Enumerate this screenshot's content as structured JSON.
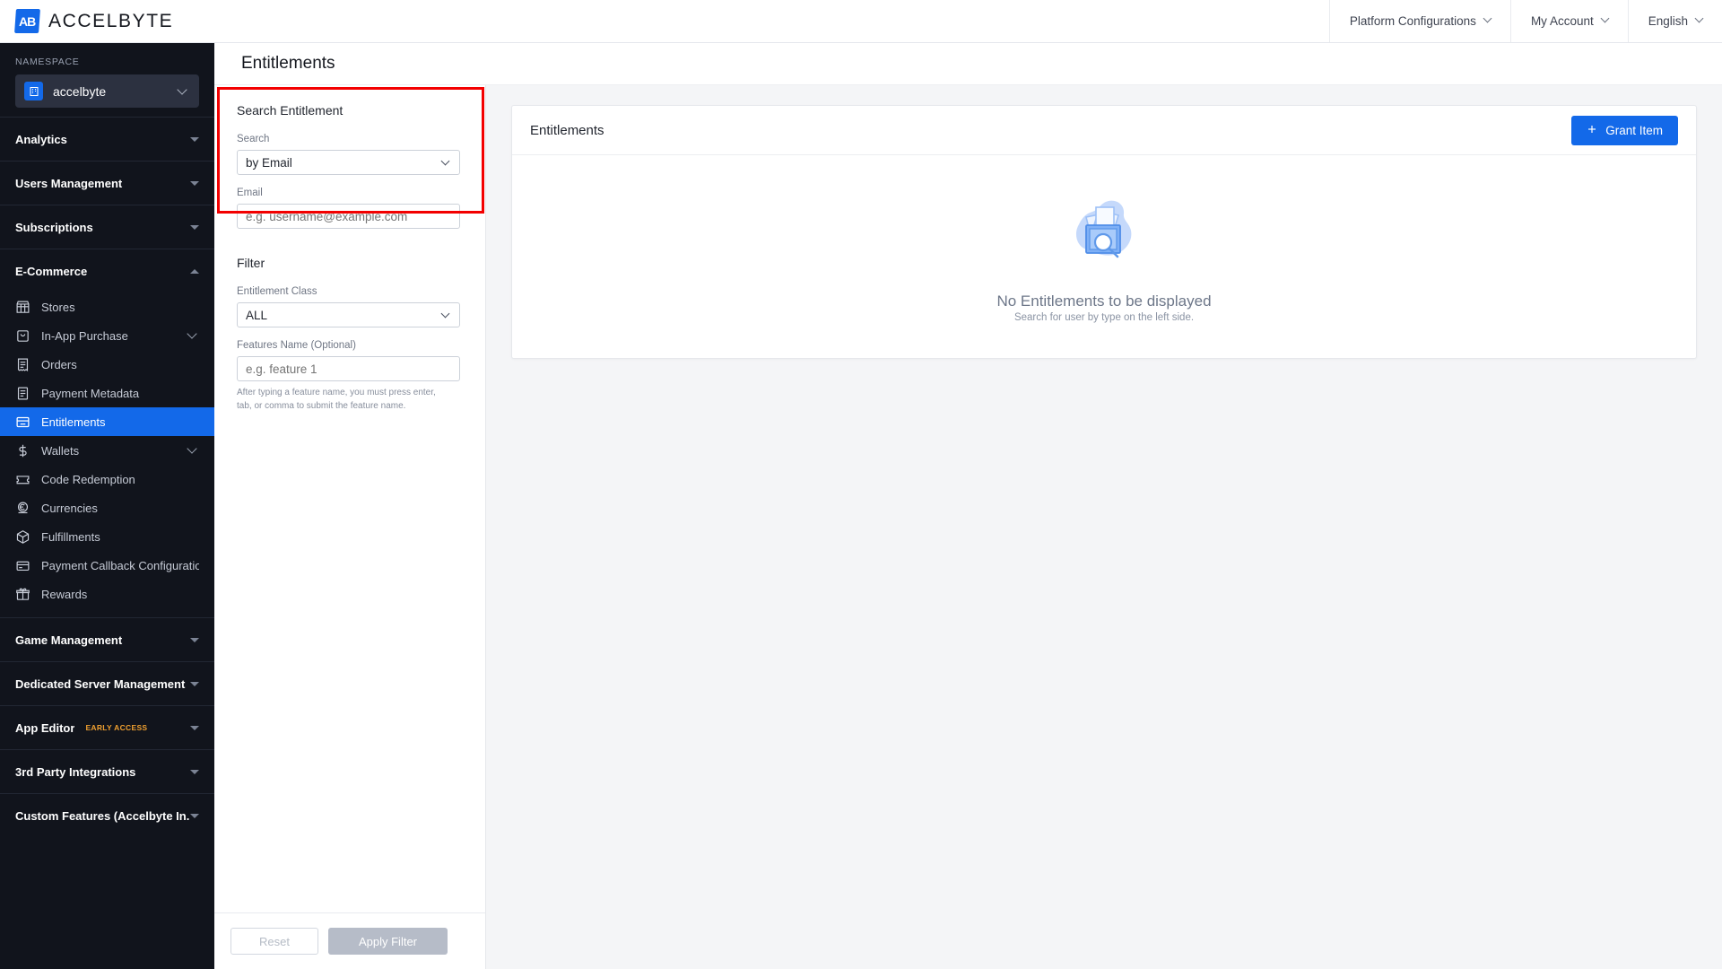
{
  "topbar": {
    "logo_mark": "accelbyte-logo-icon",
    "brand": "ACCELBYTE",
    "nav": [
      {
        "label": "Platform Configurations",
        "icon": "chevron-down-icon"
      },
      {
        "label": "My Account",
        "icon": "chevron-down-icon"
      },
      {
        "label": "English",
        "icon": "chevron-down-icon"
      }
    ]
  },
  "sidebar": {
    "namespace_label": "NAMESPACE",
    "namespace_value": "accelbyte",
    "namespace_icon": "building-icon",
    "groups": [
      {
        "label": "Analytics",
        "expanded": false
      },
      {
        "label": "Users Management",
        "expanded": false
      },
      {
        "label": "Subscriptions",
        "expanded": false
      },
      {
        "label": "E-Commerce",
        "expanded": true
      },
      {
        "label": "Game Management",
        "expanded": false
      },
      {
        "label": "Dedicated Server Management",
        "expanded": false
      },
      {
        "label": "App Editor",
        "badge": "EARLY ACCESS",
        "expanded": false
      },
      {
        "label": "3rd Party Integrations",
        "expanded": false
      },
      {
        "label": "Custom Features (Accelbyte In...",
        "expanded": false
      }
    ],
    "ecommerce_items": [
      {
        "label": "Stores",
        "icon": "store-icon",
        "active": false,
        "submenu": false
      },
      {
        "label": "In-App Purchase",
        "icon": "bag-icon",
        "active": false,
        "submenu": true
      },
      {
        "label": "Orders",
        "icon": "receipt-list-icon",
        "active": false,
        "submenu": false
      },
      {
        "label": "Payment Metadata",
        "icon": "document-icon",
        "active": false,
        "submenu": false
      },
      {
        "label": "Entitlements",
        "icon": "entitlement-card-icon",
        "active": true,
        "submenu": false
      },
      {
        "label": "Wallets",
        "icon": "dollar-icon",
        "active": false,
        "submenu": true
      },
      {
        "label": "Code Redemption",
        "icon": "ticket-icon",
        "active": false,
        "submenu": false
      },
      {
        "label": "Currencies",
        "icon": "currency-icon",
        "active": false,
        "submenu": false
      },
      {
        "label": "Fulfillments",
        "icon": "box-icon",
        "active": false,
        "submenu": false
      },
      {
        "label": "Payment Callback Configuration",
        "icon": "payment-card-icon",
        "active": false,
        "submenu": false
      },
      {
        "label": "Rewards",
        "icon": "gift-icon",
        "active": false,
        "submenu": false
      }
    ]
  },
  "page": {
    "title": "Entitlements"
  },
  "search_panel": {
    "section_title": "Search Entitlement",
    "search_label": "Search",
    "search_value": "by Email",
    "email_label": "Email",
    "email_placeholder": "e.g. username@example.com",
    "email_value": "",
    "filter_title": "Filter",
    "entitlement_class_label": "Entitlement Class",
    "entitlement_class_value": "ALL",
    "features_label": "Features Name (Optional)",
    "features_placeholder": "e.g. feature 1",
    "features_value": "",
    "features_helper": "After typing a feature name, you must press enter, tab, or comma to submit the feature name.",
    "reset_label": "Reset",
    "apply_label": "Apply Filter",
    "highlight_color": "#f30000"
  },
  "main": {
    "card_title": "Entitlements",
    "grant_button": "Grant Item",
    "grant_icon": "plus-icon",
    "empty_illustration": "folder-search-illustration",
    "empty_title": "No Entitlements to be displayed",
    "empty_subtitle": "Search for user by type on the left side."
  },
  "colors": {
    "accent": "#1369e9",
    "sidebar_bg": "#11141c",
    "sidebar_active": "#1369e9",
    "page_bg": "#f4f5f7",
    "highlight": "#f30000",
    "badge_orange": "#f0a030"
  }
}
